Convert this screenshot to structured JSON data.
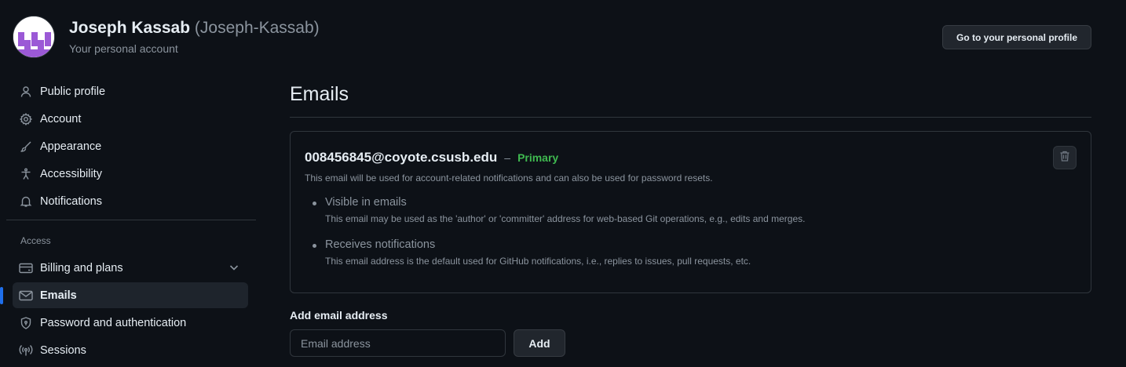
{
  "header": {
    "name": "Joseph Kassab",
    "handle": "(Joseph-Kassab)",
    "subtitle": "Your personal account",
    "profile_button": "Go to your personal profile"
  },
  "sidebar": {
    "items": [
      {
        "label": "Public profile",
        "icon": "person-icon"
      },
      {
        "label": "Account",
        "icon": "gear-icon"
      },
      {
        "label": "Appearance",
        "icon": "paintbrush-icon"
      },
      {
        "label": "Accessibility",
        "icon": "accessibility-icon"
      },
      {
        "label": "Notifications",
        "icon": "bell-icon"
      }
    ],
    "access_heading": "Access",
    "access_items": [
      {
        "label": "Billing and plans",
        "icon": "credit-card-icon"
      },
      {
        "label": "Emails",
        "icon": "mail-icon",
        "active": true
      },
      {
        "label": "Password and authentication",
        "icon": "shield-lock-icon"
      },
      {
        "label": "Sessions",
        "icon": "broadcast-icon"
      }
    ]
  },
  "main": {
    "title": "Emails",
    "email": {
      "address": "008456845@coyote.csusb.edu",
      "separator": "–",
      "badge": "Primary",
      "description": "This email will be used for account-related notifications and can also be used for password resets.",
      "bullets": [
        {
          "title": "Visible in emails",
          "description": "This email may be used as the 'author' or 'committer' address for web-based Git operations, e.g., edits and merges."
        },
        {
          "title": "Receives notifications",
          "description": "This email address is the default used for GitHub notifications, i.e., replies to issues, pull requests, etc."
        }
      ]
    },
    "add_email": {
      "label": "Add email address",
      "placeholder": "Email address",
      "value": "",
      "button": "Add"
    }
  },
  "colors": {
    "background": "#0d1117",
    "primary_badge": "#3fb950",
    "active_indicator": "#1f6feb",
    "muted_text": "#8b949e"
  }
}
